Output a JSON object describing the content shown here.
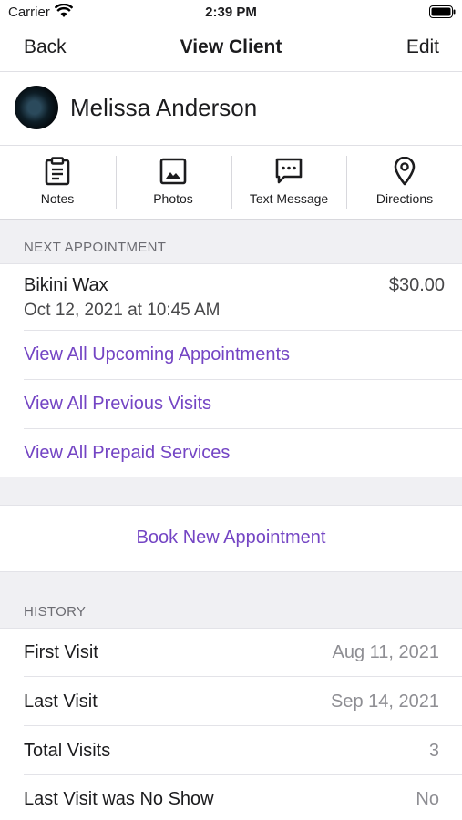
{
  "status_bar": {
    "carrier": "Carrier",
    "time": "2:39 PM"
  },
  "nav": {
    "back_label": "Back",
    "title": "View Client",
    "edit_label": "Edit"
  },
  "client": {
    "name": "Melissa Anderson"
  },
  "actions": [
    {
      "label": "Notes",
      "icon": "clipboard-icon"
    },
    {
      "label": "Photos",
      "icon": "image-icon"
    },
    {
      "label": "Text Message",
      "icon": "message-icon"
    },
    {
      "label": "Directions",
      "icon": "map-pin-icon"
    }
  ],
  "next_appointment": {
    "header": "NEXT APPOINTMENT",
    "service": "Bikini Wax",
    "price": "$30.00",
    "datetime": "Oct 12, 2021 at 10:45 AM",
    "links": [
      "View All Upcoming Appointments",
      "View All Previous Visits",
      "View All Prepaid Services"
    ]
  },
  "book_label": "Book New Appointment",
  "history": {
    "header": "HISTORY",
    "rows": [
      {
        "label": "First Visit",
        "value": "Aug 11, 2021"
      },
      {
        "label": "Last Visit",
        "value": "Sep 14, 2021"
      },
      {
        "label": "Total Visits",
        "value": "3"
      },
      {
        "label": "Last Visit was No Show",
        "value": "No"
      }
    ]
  },
  "colors": {
    "accent": "#7445c4",
    "section_bg": "#f0f0f3",
    "secondary_text": "#8e8e93"
  }
}
